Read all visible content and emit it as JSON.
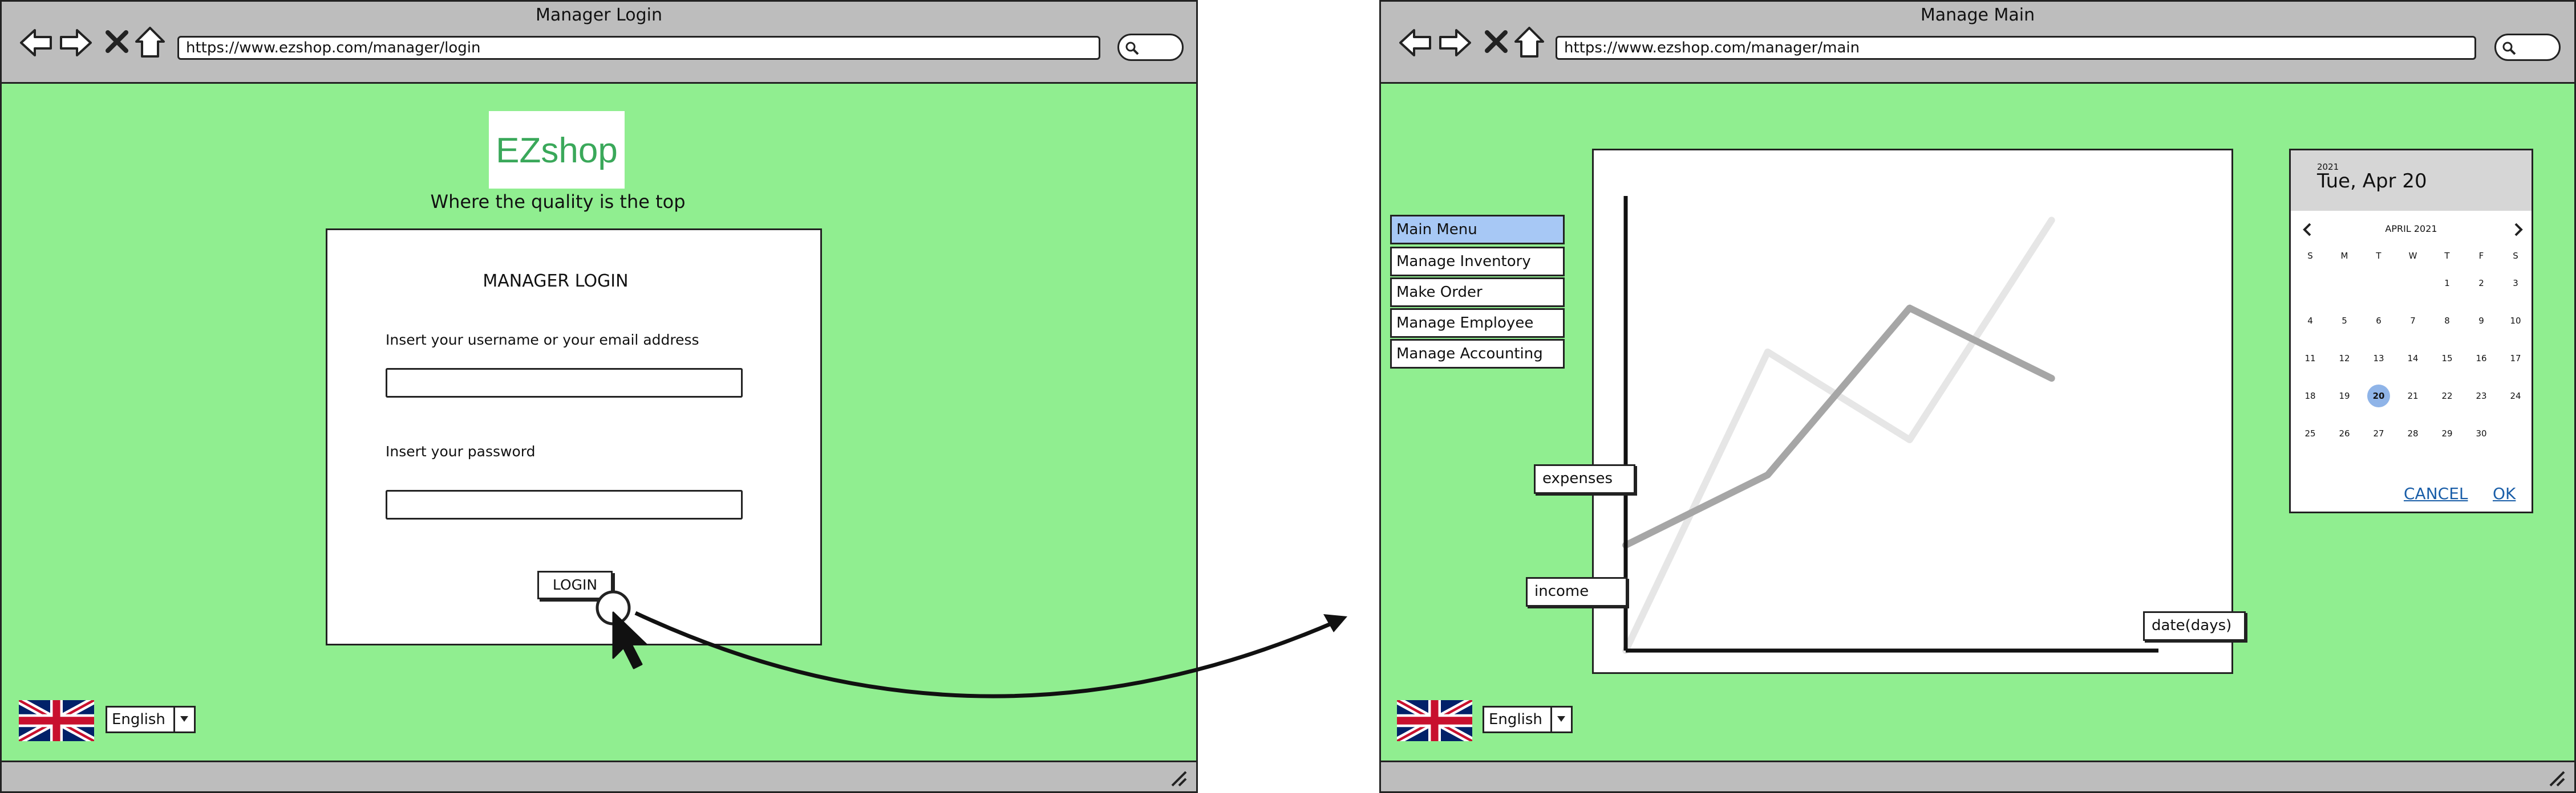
{
  "left_window": {
    "title": "Manager Login",
    "url": "https://www.ezshop.com/manager/login",
    "logo": "EZshop",
    "tagline": "Where the quality is the top",
    "form": {
      "heading": "MANAGER LOGIN",
      "username_label": "Insert your username or your email address",
      "username_value": "",
      "password_label": "Insert your password",
      "password_value": "",
      "login_button": "LOGIN"
    },
    "language": "English"
  },
  "right_window": {
    "title": "Manage Main",
    "url": "https://www.ezshop.com/manager/main",
    "menu": [
      {
        "label": "Main Menu",
        "selected": true
      },
      {
        "label": "Manage Inventory",
        "selected": false
      },
      {
        "label": "Make Order",
        "selected": false
      },
      {
        "label": "Manage Employee",
        "selected": false
      },
      {
        "label": "Manage Accounting",
        "selected": false
      }
    ],
    "chart_labels": {
      "expenses": "expenses",
      "income": "income",
      "x_axis": "date(days)"
    },
    "calendar": {
      "year": "2021",
      "selected_date": "Tue, Apr 20",
      "month": "APRIL 2021",
      "weekdays": [
        "S",
        "M",
        "T",
        "W",
        "T",
        "F",
        "S"
      ],
      "weeks": [
        [
          "",
          "",
          "",
          "",
          "1",
          "2",
          "3"
        ],
        [
          "4",
          "5",
          "6",
          "7",
          "8",
          "9",
          "10"
        ],
        [
          "11",
          "12",
          "13",
          "14",
          "15",
          "16",
          "17"
        ],
        [
          "18",
          "19",
          "20",
          "21",
          "22",
          "23",
          "24"
        ],
        [
          "25",
          "26",
          "27",
          "28",
          "29",
          "30",
          ""
        ]
      ],
      "selected_day": "20",
      "cancel": "CANCEL",
      "ok": "OK"
    },
    "language": "English"
  },
  "chart_data": {
    "type": "line",
    "title": "",
    "xlabel": "date(days)",
    "ylabel": "",
    "x": [
      0,
      1,
      2,
      3
    ],
    "series": [
      {
        "name": "expenses",
        "values": [
          1.2,
          2.0,
          3.9,
          3.1
        ],
        "color": "#a6a6a6"
      },
      {
        "name": "income",
        "values": [
          0,
          3.4,
          2.4,
          4.9
        ],
        "color": "#e6e6e6"
      }
    ],
    "xlim": [
      0,
      3.6
    ],
    "ylim": [
      0,
      5.5
    ],
    "grid": false
  },
  "colors": {
    "page_background": "#90ee90",
    "chrome": "#bdbdbd",
    "menu_selected": "#a7c8f5",
    "calendar_selected": "#8fb4e8",
    "link": "#1a5ea8",
    "logo_text": "#3aa85a"
  },
  "icons": [
    "back-arrow-icon",
    "forward-arrow-icon",
    "close-x-icon",
    "home-icon",
    "search-icon",
    "resize-grip-icon",
    "uk-flag-icon",
    "dropdown-arrow-icon",
    "mouse-cursor-icon",
    "click-circle-icon",
    "chevron-left-icon",
    "chevron-right-icon"
  ]
}
